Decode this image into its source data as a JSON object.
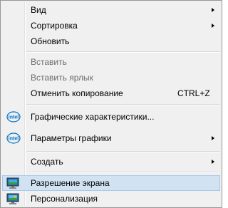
{
  "menu": {
    "items": [
      {
        "label": "Вид",
        "submenu": true,
        "disabled": false
      },
      {
        "label": "Сортировка",
        "submenu": true,
        "disabled": false
      },
      {
        "label": "Обновить",
        "submenu": false,
        "disabled": false
      },
      {
        "label": "Вставить",
        "submenu": false,
        "disabled": true
      },
      {
        "label": "Вставить ярлык",
        "submenu": false,
        "disabled": true
      },
      {
        "label": "Отменить копирование",
        "shortcut": "CTRL+Z",
        "submenu": false,
        "disabled": false
      },
      {
        "label": "Графические характеристики...",
        "icon": "intel-icon",
        "submenu": false,
        "disabled": false
      },
      {
        "label": "Параметры графики",
        "icon": "intel-icon",
        "submenu": true,
        "disabled": false
      },
      {
        "label": "Создать",
        "submenu": true,
        "disabled": false
      },
      {
        "label": "Разрешение экрана",
        "icon": "display-icon",
        "highlighted": true,
        "submenu": false,
        "disabled": false
      },
      {
        "label": "Персонализация",
        "icon": "personalize-icon",
        "submenu": false,
        "disabled": false
      }
    ],
    "intel_text": "intel",
    "colors": {
      "background": "#f0f0f0",
      "highlight": "#d1e2f2",
      "highlight_border": "#a8c8e8",
      "disabled_text": "#6d6d6d",
      "intel_blue": "#0071c5"
    }
  }
}
